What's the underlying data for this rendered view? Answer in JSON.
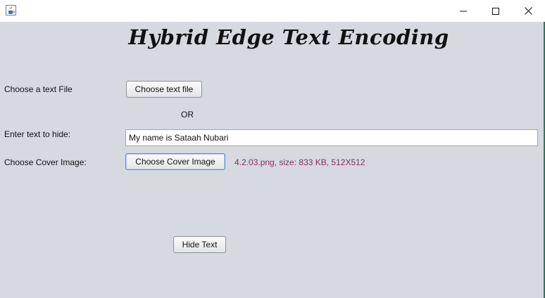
{
  "window": {
    "icon": "java-cup-icon",
    "controls": {
      "minimize": "minimize-icon",
      "maximize": "maximize-icon",
      "close": "close-icon"
    }
  },
  "header": {
    "title": "Hybrid Edge Text Encoding"
  },
  "form": {
    "text_file_label": "Choose a text File",
    "text_file_button": "Choose text file",
    "or_label": "OR",
    "enter_text_label": "Enter text to hide:",
    "text_input_value": "My name is Sataah Nubari",
    "cover_image_label": "Choose Cover Image:",
    "cover_image_button": "Choose Cover Image",
    "cover_image_info": "4.2.03.png, size: 833 KB, 512X512",
    "hide_button": "Hide Text"
  },
  "colors": {
    "background": "#d6d9e0",
    "info_text": "#8a3050",
    "focus_border": "#6a8cc7"
  }
}
